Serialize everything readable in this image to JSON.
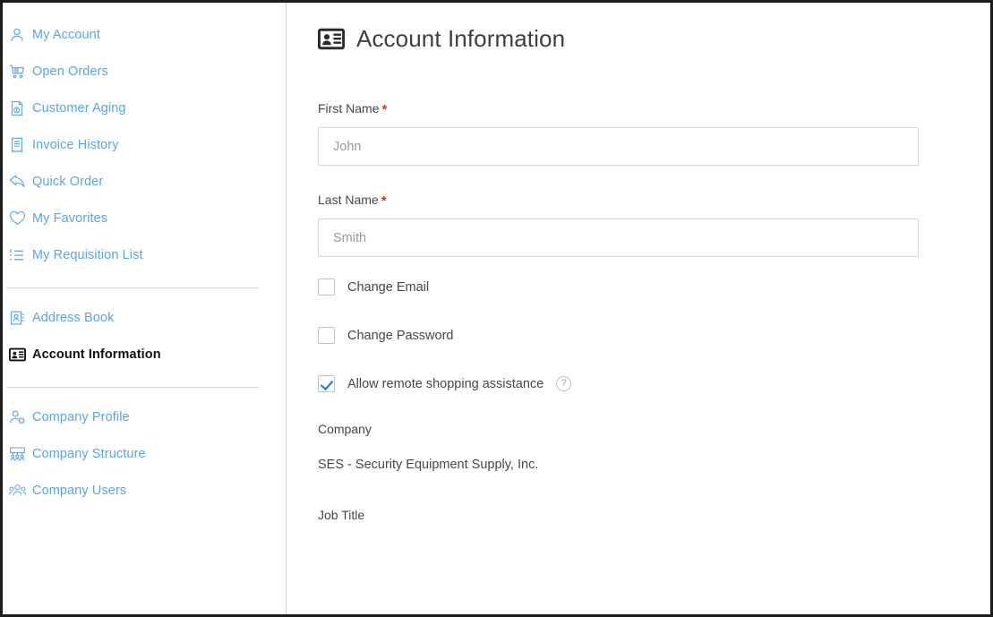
{
  "sidebar": {
    "groups": [
      {
        "items": [
          {
            "label": "My Account",
            "icon": "user-icon",
            "active": false
          },
          {
            "label": "Open Orders",
            "icon": "shopping-cart-icon",
            "active": false
          },
          {
            "label": "Customer Aging",
            "icon": "invoice-dollar-icon",
            "active": false
          },
          {
            "label": "Invoice History",
            "icon": "receipt-icon",
            "active": false
          },
          {
            "label": "Quick Order",
            "icon": "reply-arrow-icon",
            "active": false
          },
          {
            "label": "My Favorites",
            "icon": "heart-icon",
            "active": false
          },
          {
            "label": "My Requisition List",
            "icon": "list-icon",
            "active": false
          }
        ]
      },
      {
        "items": [
          {
            "label": "Address Book",
            "icon": "address-book-icon",
            "active": false
          },
          {
            "label": "Account Information",
            "icon": "id-card-icon",
            "active": true
          }
        ]
      },
      {
        "items": [
          {
            "label": "Company Profile",
            "icon": "user-gear-icon",
            "active": false
          },
          {
            "label": "Company Structure",
            "icon": "org-chart-icon",
            "active": false
          },
          {
            "label": "Company Users",
            "icon": "users-group-icon",
            "active": false
          }
        ]
      }
    ]
  },
  "main": {
    "header": {
      "icon": "id-card-icon",
      "title": "Account Information"
    },
    "fields": {
      "first_name": {
        "label": "First Name",
        "required_marker": "*",
        "value": "",
        "placeholder": "John"
      },
      "last_name": {
        "label": "Last Name",
        "required_marker": "*",
        "value": "",
        "placeholder": "Smith"
      }
    },
    "checkboxes": [
      {
        "label": "Change Email",
        "checked": false,
        "help": false
      },
      {
        "label": "Change Password",
        "checked": false,
        "help": false
      },
      {
        "label": "Allow remote shopping assistance",
        "checked": true,
        "help": true,
        "help_glyph": "?"
      }
    ],
    "company": {
      "label": "Company",
      "value": "SES - Security Equipment Supply, Inc."
    },
    "job_title": {
      "label": "Job Title"
    }
  },
  "colors": {
    "link": "#5aa5e6",
    "accent": "#1979c3",
    "required": "#e02b27",
    "text": "#44474b",
    "border": "#d6d6d6"
  }
}
